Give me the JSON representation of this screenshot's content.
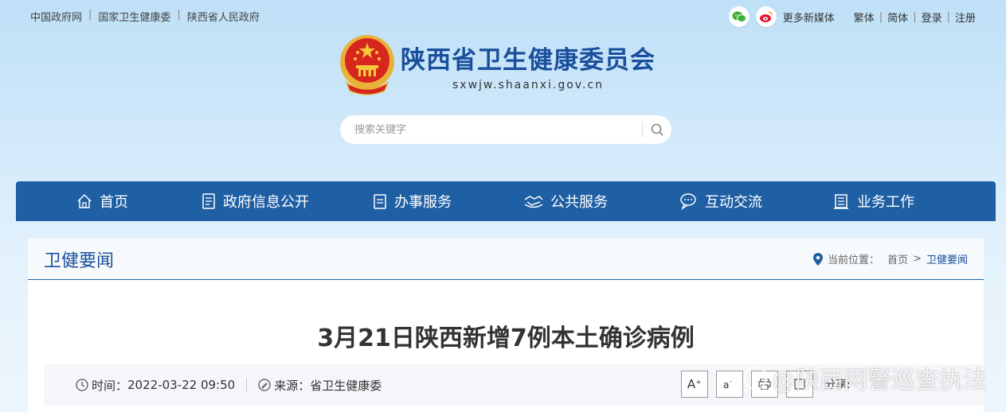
{
  "top_links": [
    "中国政府网",
    "国家卫生健康委",
    "陕西省人民政府"
  ],
  "top_right": {
    "media_label": "更多新媒体",
    "links": [
      "繁体",
      "简体",
      "登录",
      "注册"
    ]
  },
  "site": {
    "name": "陕西省卫生健康委员会",
    "url": "sxwjw.shaanxi.gov.cn"
  },
  "search": {
    "placeholder": "搜索关键字"
  },
  "nav": [
    {
      "label": "首页",
      "icon": "home-icon"
    },
    {
      "label": "政府信息公开",
      "icon": "document-icon"
    },
    {
      "label": "办事服务",
      "icon": "clipboard-icon"
    },
    {
      "label": "公共服务",
      "icon": "handshake-icon"
    },
    {
      "label": "互动交流",
      "icon": "chat-icon"
    },
    {
      "label": "业务工作",
      "icon": "book-icon"
    }
  ],
  "section": {
    "title": "卫健要闻",
    "breadcrumb_label": "当前位置：",
    "breadcrumb_home": "首页",
    "breadcrumb_sep": ">",
    "breadcrumb_current": "卫健要闻"
  },
  "article": {
    "title": "3月21日陕西新增7例本土确诊病例",
    "time_label": "时间：",
    "time_value": "2022-03-22 09:50",
    "source_label": "来源：",
    "source_value": "省卫生健康委",
    "font_larger": "A⁺",
    "share_label": "分享:"
  },
  "watermark": "@陕西网警巡查执法",
  "colors": {
    "nav_bg": "#1f5fa4",
    "title_blue": "#1a4f9c"
  }
}
